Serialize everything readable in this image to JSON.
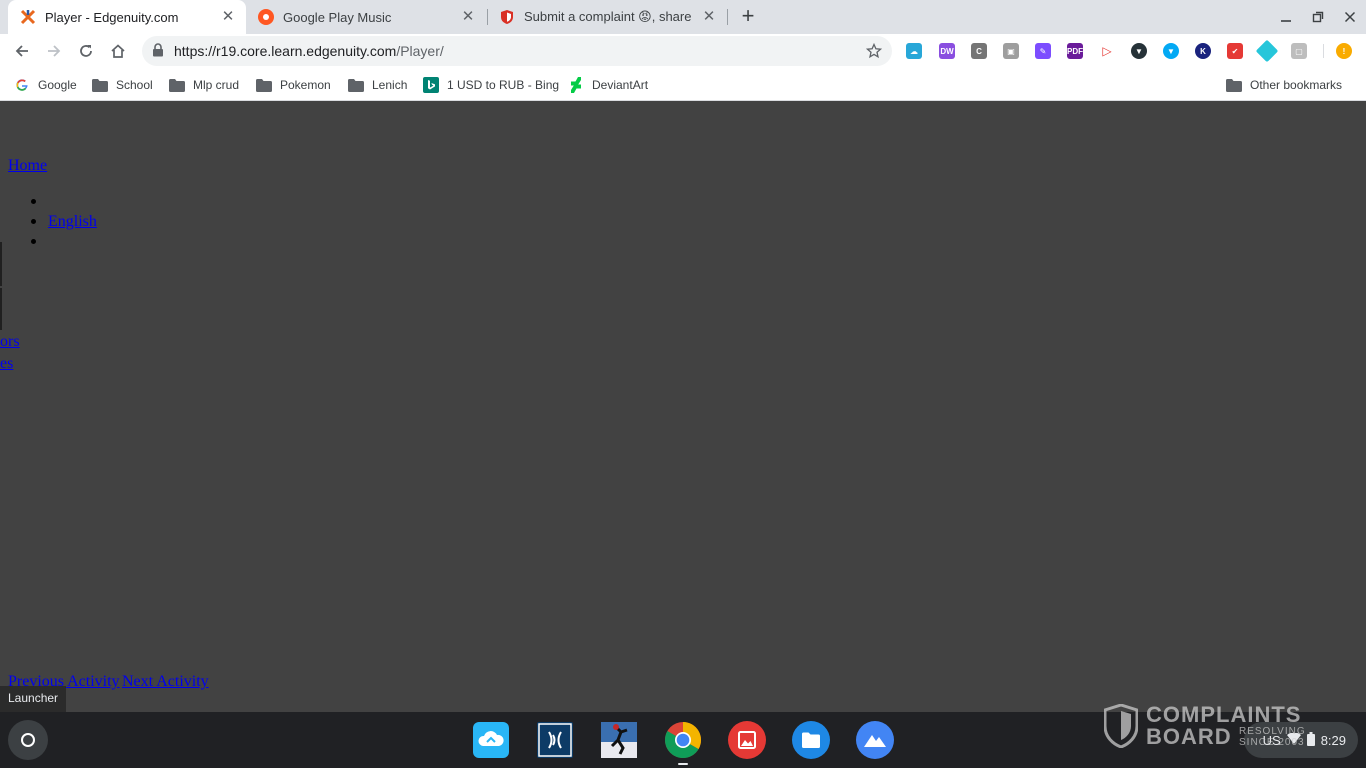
{
  "tabs": [
    {
      "title": "Player - Edgenuity.com",
      "active": true
    },
    {
      "title": "Google Play Music",
      "active": false
    },
    {
      "title": "Submit a complaint 😡, share yo",
      "active": false
    }
  ],
  "toolbar": {
    "url_host": "https://r19.core.learn.edgenuity.com",
    "url_path": "/Player/"
  },
  "bookmarks": [
    "Google",
    "School",
    "Mlp crud",
    "Pokemon",
    "Lenich",
    "1 USD to RUB - Bing",
    "DeviantArt"
  ],
  "other_bookmarks": "Other bookmarks",
  "page": {
    "home_link": "Home",
    "english_link": "English",
    "ors_link": "ors",
    "es_link": "es",
    "prev_activity": "Previous Activity",
    "next_activity": "Next Activity"
  },
  "launcher_tooltip": "Launcher",
  "tray": {
    "ime": "US",
    "time": "8:29"
  },
  "watermark": {
    "line1": "COMPLAINTS",
    "line2": "BOARD",
    "tagline": "RESOLVING SINCE 2003"
  },
  "colors": {
    "link": "#0000ee",
    "page_bg": "#424242",
    "shelf_bg": "#202124"
  }
}
